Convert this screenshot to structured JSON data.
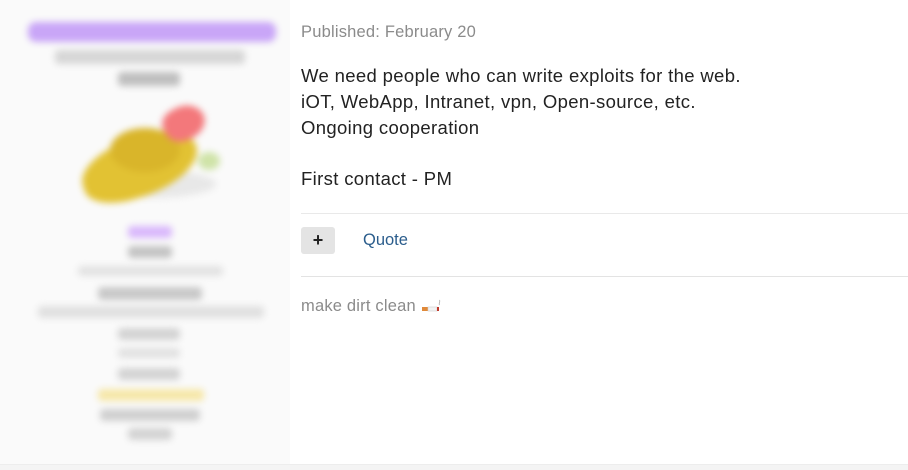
{
  "post": {
    "published": "Published: February 20",
    "body_lines": [
      "We need people who can write exploits for the web.",
      "iOT, WebApp, Intranet, vpn, Open-source, etc.",
      "Ongoing cooperation",
      "First contact - PM"
    ],
    "actions": {
      "plus_icon": "plus-icon",
      "plus_symbol": "+",
      "quote_label": "Quote"
    },
    "signature": {
      "text": "make dirt clean",
      "icon": "cigarette-emoji"
    }
  },
  "colors": {
    "username_highlight": "#c9a6f7",
    "link": "#2b5d8c",
    "muted_text": "#8b8b8b"
  }
}
